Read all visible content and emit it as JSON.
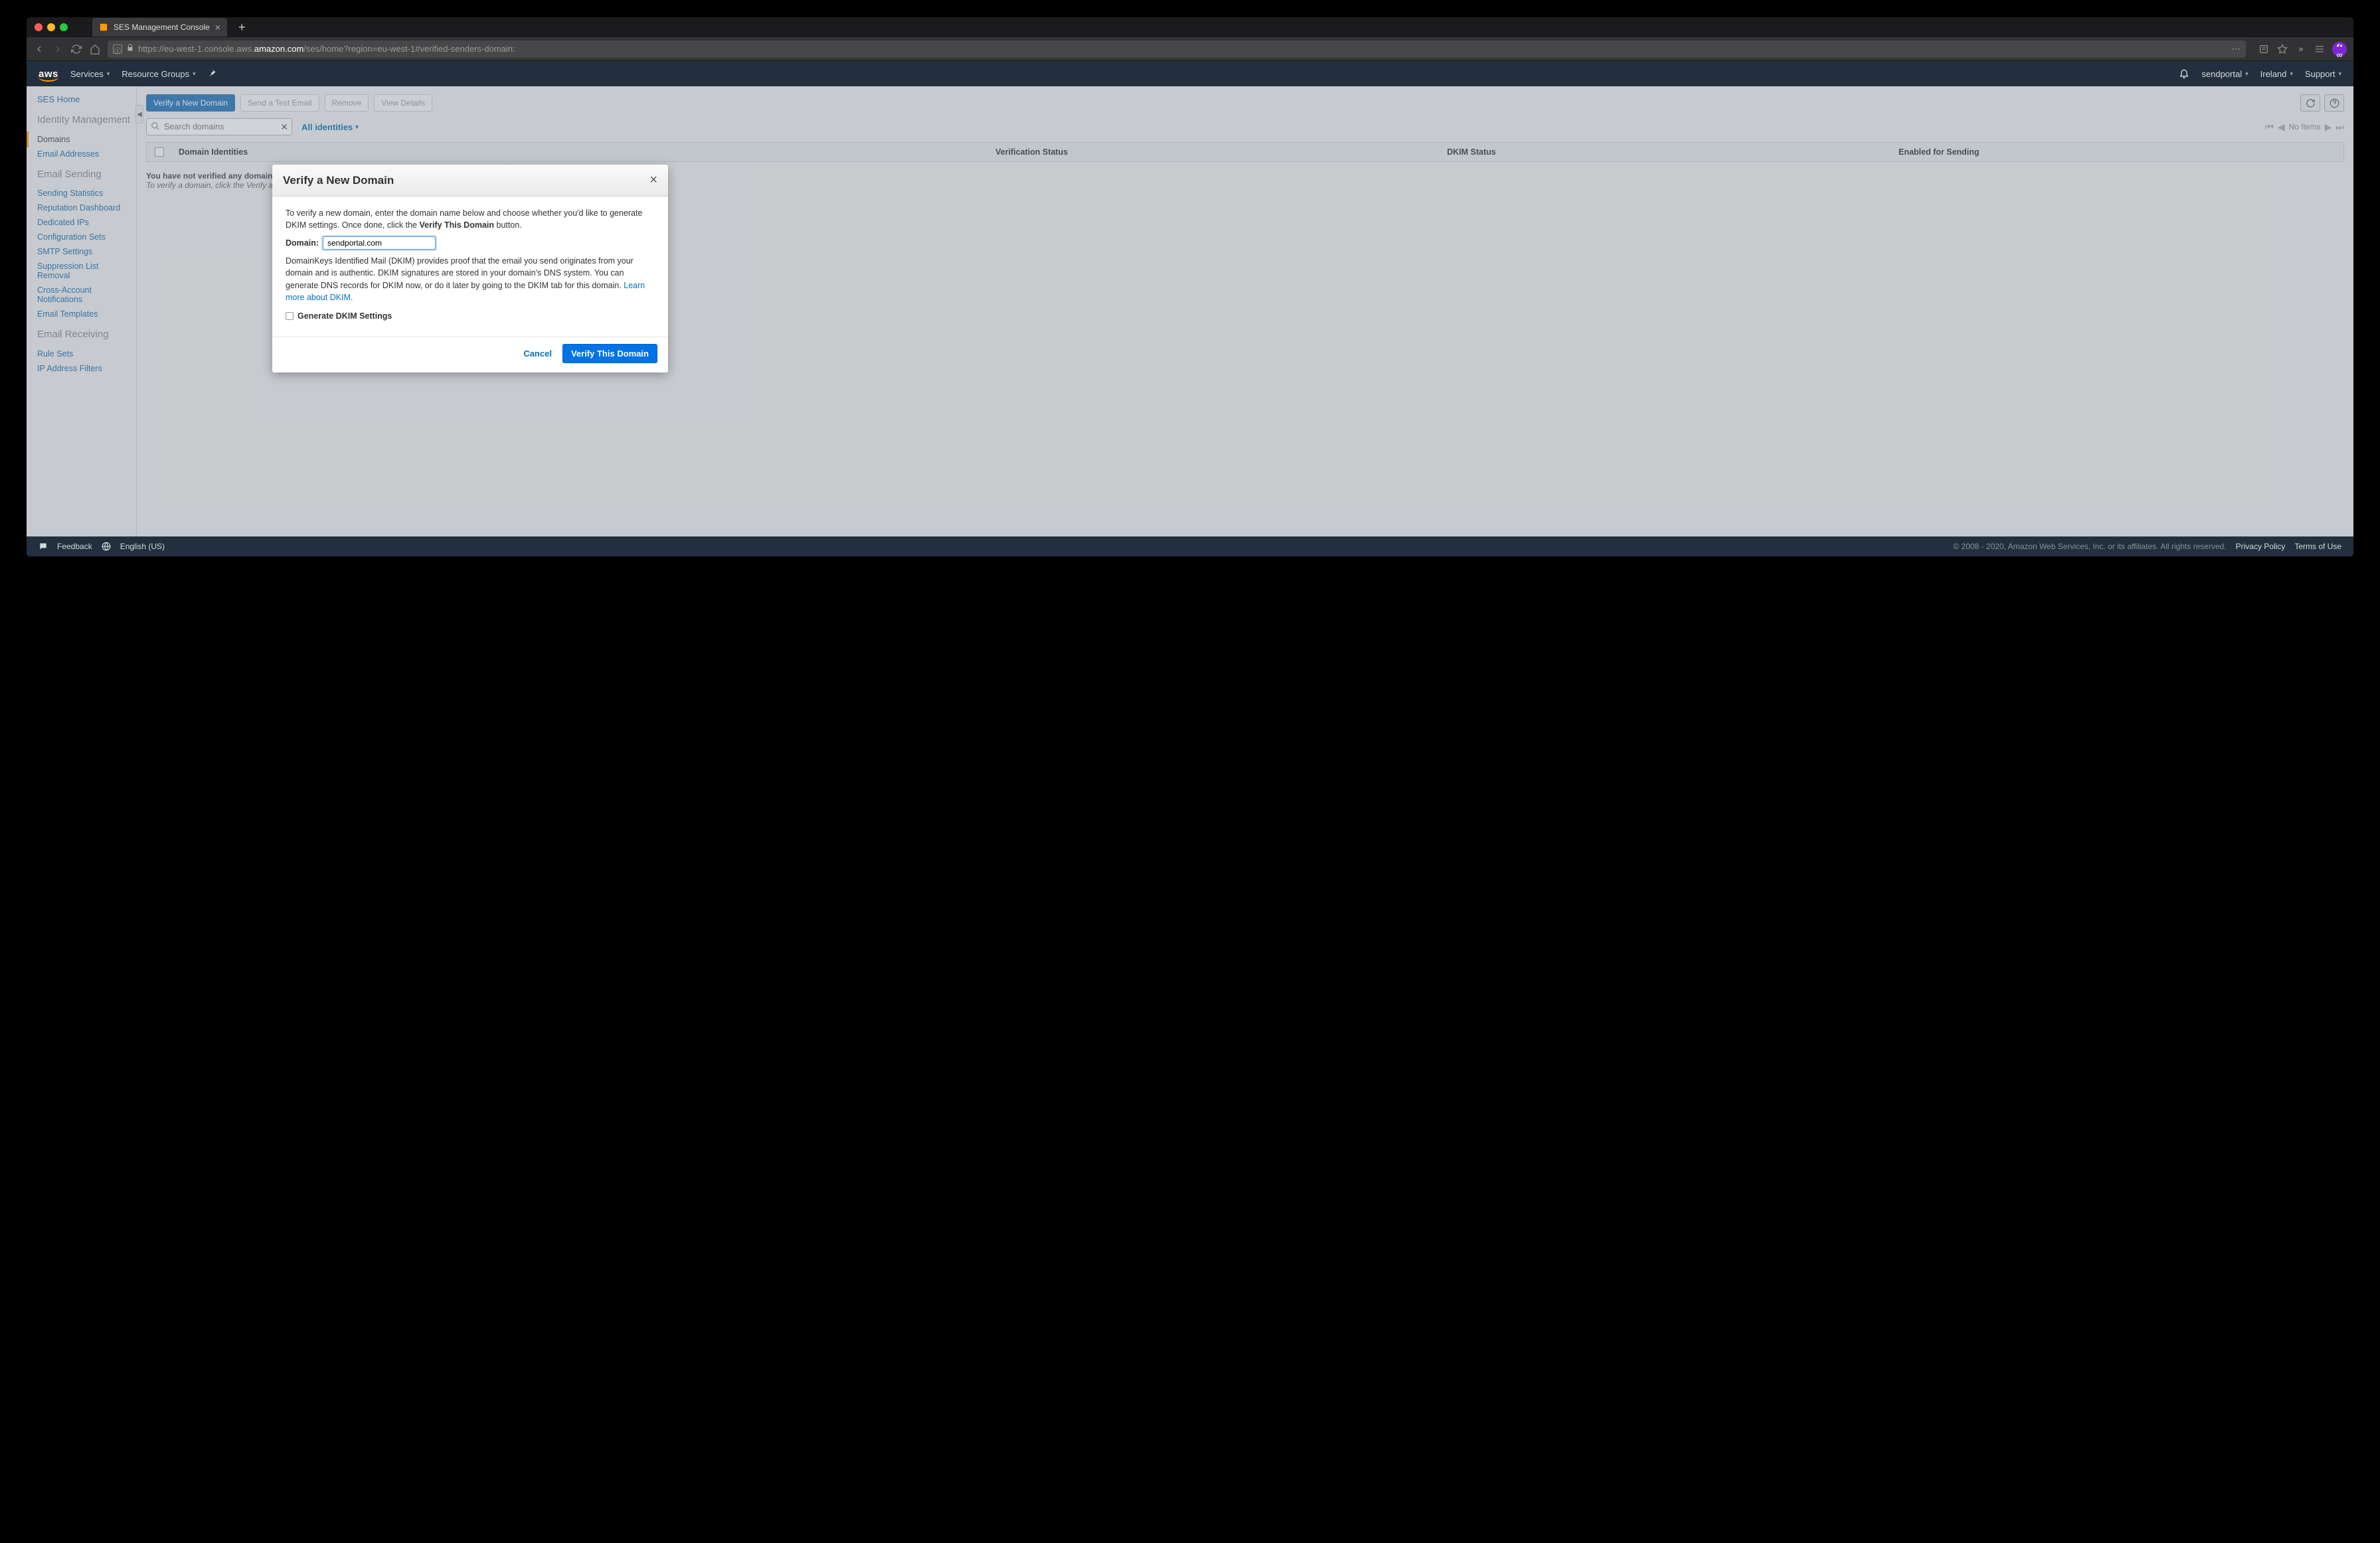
{
  "browser": {
    "tab_title": "SES Management Console",
    "url_pre": "https://eu-west-1.console.aws.",
    "url_host": "amazon.com",
    "url_post": "/ses/home?region=eu-west-1#verified-senders-domain:"
  },
  "header": {
    "logo": "aws",
    "services": "Services",
    "resource_groups": "Resource Groups",
    "account": "sendportal",
    "region": "Ireland",
    "support": "Support"
  },
  "sidebar": {
    "home": "SES Home",
    "section_identity": "Identity Management",
    "item_domains": "Domains",
    "item_emails": "Email Addresses",
    "section_sending": "Email Sending",
    "item_stats": "Sending Statistics",
    "item_rep": "Reputation Dashboard",
    "item_ips": "Dedicated IPs",
    "item_config": "Configuration Sets",
    "item_smtp": "SMTP Settings",
    "item_suppress": "Suppression List Removal",
    "item_cross": "Cross-Account Notifications",
    "item_templates": "Email Templates",
    "section_receiving": "Email Receiving",
    "item_rules": "Rule Sets",
    "item_ipfilters": "IP Address Filters"
  },
  "toolbar": {
    "verify_new": "Verify a New Domain",
    "send_test": "Send a Test Email",
    "remove": "Remove",
    "view_details": "View Details"
  },
  "search": {
    "placeholder": "Search domains",
    "filter": "All identities"
  },
  "pager": {
    "text": "No Items"
  },
  "table": {
    "col_domain": "Domain Identities",
    "col_verif": "Verification Status",
    "col_dkim": "DKIM Status",
    "col_enabled": "Enabled for Sending"
  },
  "empty": {
    "line1": "You have not verified any domains.",
    "line2": "To verify a domain, click the Verify a Ne"
  },
  "modal": {
    "title": "Verify a New Domain",
    "p1a": "To verify a new domain, enter the domain name below and choose whether you'd like to generate DKIM settings. Once done, click the ",
    "p1b": "Verify This Domain",
    "p1c": " button.",
    "domain_label": "Domain:",
    "domain_value": "sendportal.com",
    "p2a": "DomainKeys Identified Mail (DKIM) provides proof that the email you send originates from your domain and is authentic. DKIM signatures are stored in your domain's DNS system. You can generate DNS records for DKIM now, or do it later by going to the DKIM tab for this domain. ",
    "p2link": "Learn more about DKIM.",
    "gen_dkim": "Generate DKIM Settings",
    "cancel": "Cancel",
    "verify": "Verify This Domain"
  },
  "footer": {
    "feedback": "Feedback",
    "language": "English (US)",
    "copyright": "© 2008 - 2020, Amazon Web Services, Inc. or its affiliates. All rights reserved.",
    "privacy": "Privacy Policy",
    "terms": "Terms of Use"
  }
}
